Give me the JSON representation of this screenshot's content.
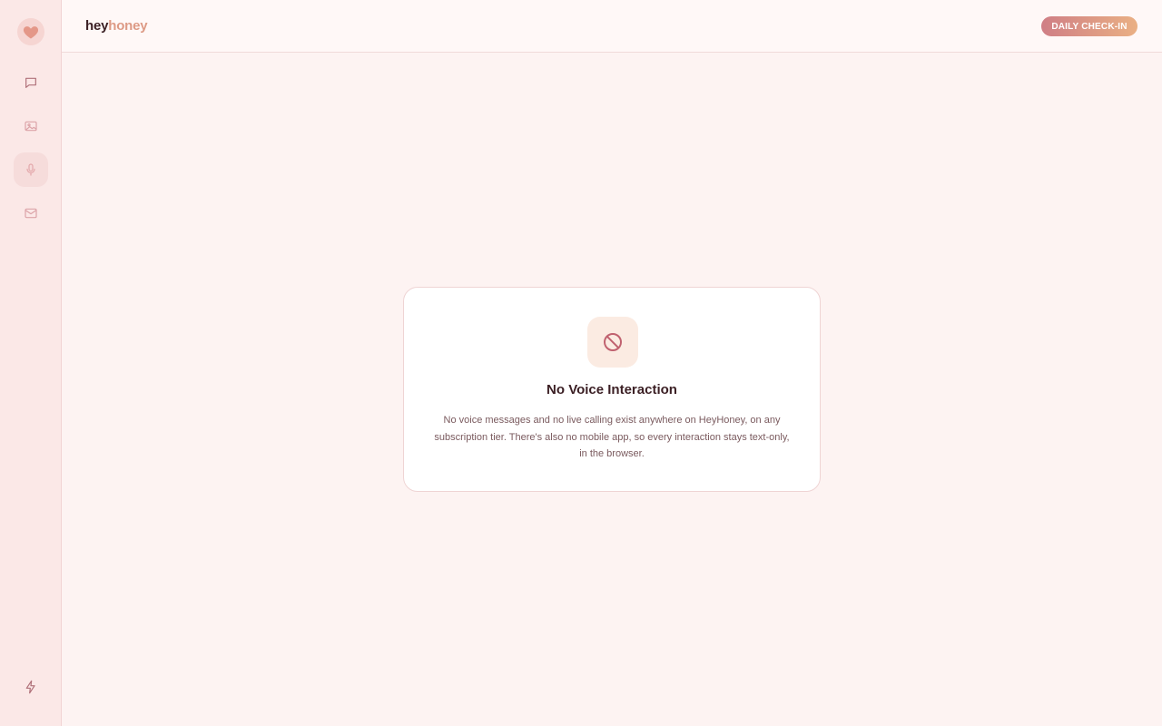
{
  "app": {
    "brand_part1": "hey",
    "brand_part2": "honey",
    "logo_icon": "heart-icon"
  },
  "topbar": {
    "checkin_label": "DAILY CHECK-IN"
  },
  "sidebar": {
    "items": [
      {
        "icon": "chat-icon",
        "active": false
      },
      {
        "icon": "image-icon",
        "active": false
      },
      {
        "icon": "microphone-icon",
        "active": true
      },
      {
        "icon": "mail-icon",
        "active": false
      }
    ],
    "bottom_icon": "lightning-icon"
  },
  "notice": {
    "icon": "prohibited-icon",
    "title": "No Voice Interaction",
    "body": "No voice messages and no live calling exist anywhere on HeyHoney, on any subscription tier. There's also no mobile app, so every interaction stays text-only, in the browser."
  },
  "colors": {
    "accent": "#dd9a85",
    "button_gradient_start": "#cf7e85",
    "button_gradient_end": "#eab084",
    "icon_red": "#c0616f"
  }
}
